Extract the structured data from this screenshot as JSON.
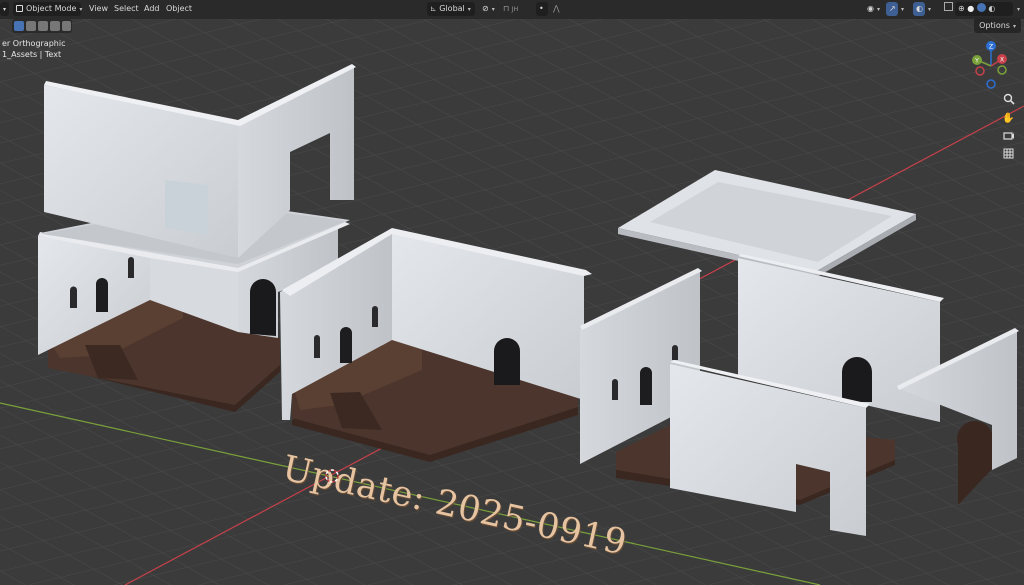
{
  "header": {
    "mode_label": "Object Mode",
    "menus": [
      "View",
      "Select",
      "Add",
      "Object"
    ],
    "transform_orientation": "Global",
    "prop_label": "JH"
  },
  "viewport": {
    "view_name": "er Orthographic",
    "collection_info": "1_Assets | Text",
    "options_label": "Options"
  },
  "gizmo": {
    "x": "X",
    "y": "Y",
    "z": "Z"
  },
  "overlay": {
    "text": "Update: 2025-0919"
  },
  "icons": {
    "zoom": "zoom-icon",
    "pan": "hand-pan-icon",
    "camera": "camera-icon",
    "grid": "grid-icon"
  },
  "colors": {
    "grid_bg": "#3b3b3b",
    "x_axis": "#c6414a",
    "y_axis": "#7aa13a",
    "wall": "#dcdfe3",
    "floor": "#4a332b",
    "text": "#e6c3a1"
  }
}
